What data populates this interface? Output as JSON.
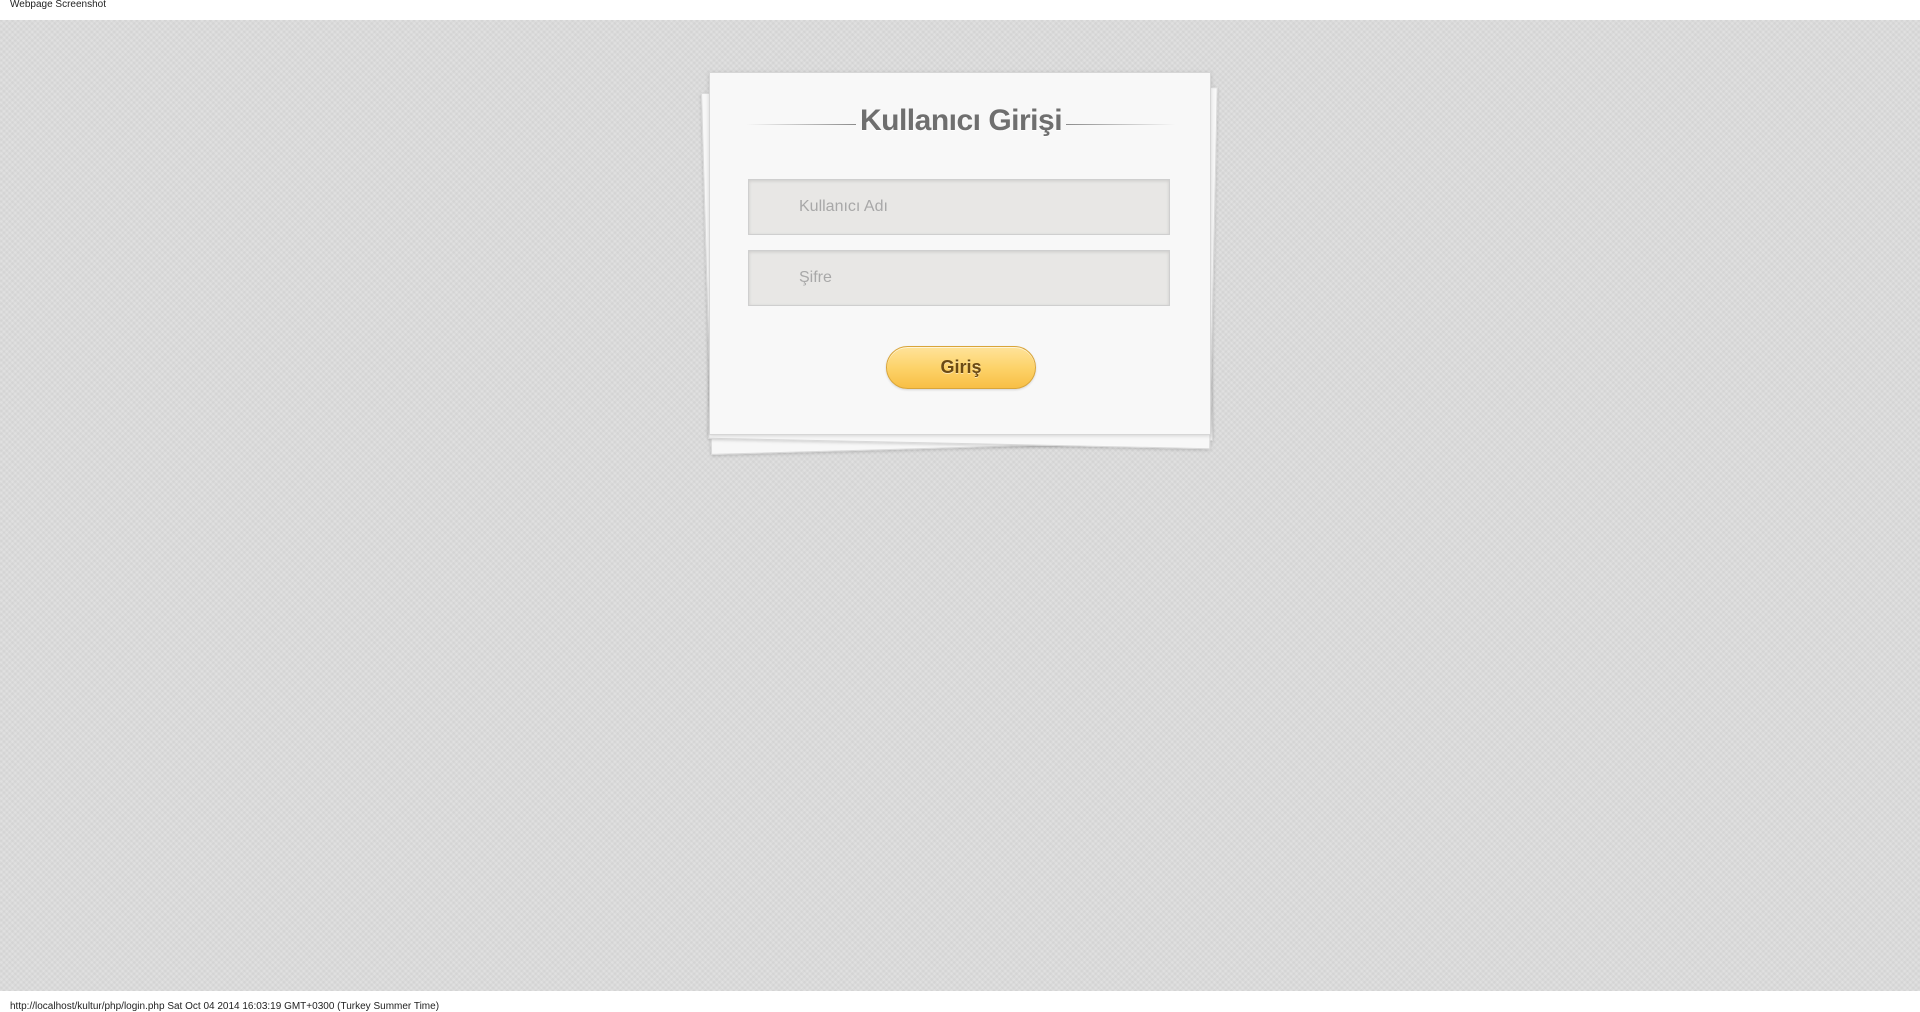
{
  "window": {
    "caption": "Webpage Screenshot"
  },
  "login_form": {
    "title": "Kullanıcı Girişi",
    "username_placeholder": "Kullanıcı Adı",
    "username_value": "",
    "password_placeholder": "Şifre",
    "password_value": "",
    "submit_label": "Giriş"
  },
  "footer": {
    "status_text": "http://localhost/kultur/php/login.php Sat Oct 04 2014 16:03:19 GMT+0300 (Turkey Summer Time)"
  },
  "colors": {
    "background": "#dcdcdc",
    "card": "#f8f8f8",
    "title_text": "#6f6f6f",
    "button_top": "#fee39a",
    "button_bottom": "#f8bf45",
    "button_text": "#6b4a14"
  }
}
